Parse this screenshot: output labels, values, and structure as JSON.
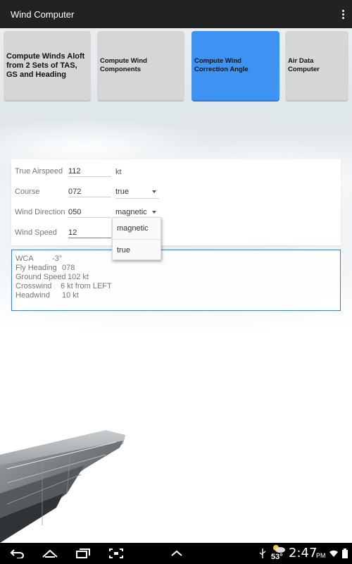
{
  "app": {
    "title": "Wind Computer"
  },
  "modes": [
    {
      "label": "Compute Winds Aloft from 2 Sets of TAS, GS and Heading",
      "active": false
    },
    {
      "label": "Compute Wind Components",
      "active": false
    },
    {
      "label": "Compute Wind Correction Angle",
      "active": true
    },
    {
      "label": "Air Data Computer",
      "active": false
    }
  ],
  "form": {
    "true_airspeed": {
      "label": "True Airspeed",
      "value": "112",
      "unit": "kt"
    },
    "course": {
      "label": "Course",
      "value": "072",
      "reference": "true"
    },
    "wind_direction": {
      "label": "Wind Direction",
      "value": "050",
      "reference": "magnetic"
    },
    "wind_speed": {
      "label": "Wind Speed",
      "value": "12"
    }
  },
  "dropdown": {
    "options": [
      "magnetic",
      "true"
    ]
  },
  "results": {
    "wca": {
      "label": "WCA",
      "value": "-3°"
    },
    "fly_heading": {
      "label": "Fly Heading",
      "value": "078"
    },
    "ground_speed": {
      "label": "Ground Speed",
      "value": "102 kt"
    },
    "crosswind": {
      "label": "Crosswind",
      "value": "6 kt from LEFT"
    },
    "headwind": {
      "label": "Headwind",
      "value": "10 kt"
    }
  },
  "status_bar": {
    "time": "2:47",
    "ampm": "PM",
    "temperature": "53°"
  },
  "colors": {
    "accent": "#3e93f2",
    "action_bar": "#222222",
    "result_border": "#3e7ed8",
    "focus_underline": "#3b9c8f"
  }
}
